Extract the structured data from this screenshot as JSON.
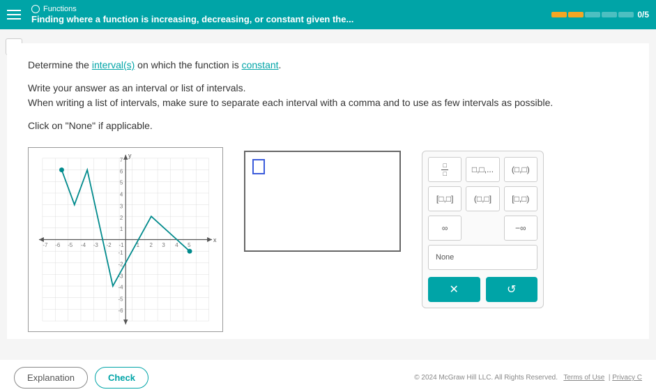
{
  "header": {
    "category": "Functions",
    "title": "Finding where a function is increasing, decreasing, or constant given the...",
    "score": "0/5"
  },
  "question": {
    "prefix": "Determine the ",
    "link1": "interval(s)",
    "middle": " on which the function is ",
    "link2": "constant",
    "suffix": "."
  },
  "instruction": {
    "line1": "Write your answer as an interval or list of intervals.",
    "line2": "When writing a list of intervals, make sure to separate each interval with a comma and to use as few intervals as possible.",
    "line3": "Click on \"None\" if applicable."
  },
  "keypad": {
    "frac_num": "□",
    "frac_den": "□",
    "list": "□,□,...",
    "open_open": "(□,□)",
    "closed_closed": "[□,□]",
    "open_closed": "(□,□]",
    "closed_open": "[□,□)",
    "infinity": "∞",
    "neg_infinity": "−∞",
    "none": "None",
    "clear": "✕",
    "reset": "↺"
  },
  "buttons": {
    "explanation": "Explanation",
    "check": "Check"
  },
  "footer": {
    "copyright": "© 2024 McGraw Hill LLC. All Rights Reserved.",
    "terms": "Terms of Use",
    "privacy": "Privacy C"
  },
  "chart_data": {
    "type": "line",
    "title": "",
    "xlabel": "x",
    "ylabel": "y",
    "xlim": [
      -7,
      7
    ],
    "ylim": [
      -7,
      7
    ],
    "points": [
      {
        "x": -5,
        "y": 6
      },
      {
        "x": -4,
        "y": 3
      },
      {
        "x": -3,
        "y": 6
      },
      {
        "x": -1,
        "y": -4
      },
      {
        "x": 2,
        "y": 2
      },
      {
        "x": 4,
        "y": 0
      },
      {
        "x": 5,
        "y": -1
      }
    ],
    "endpoints_filled": true
  }
}
